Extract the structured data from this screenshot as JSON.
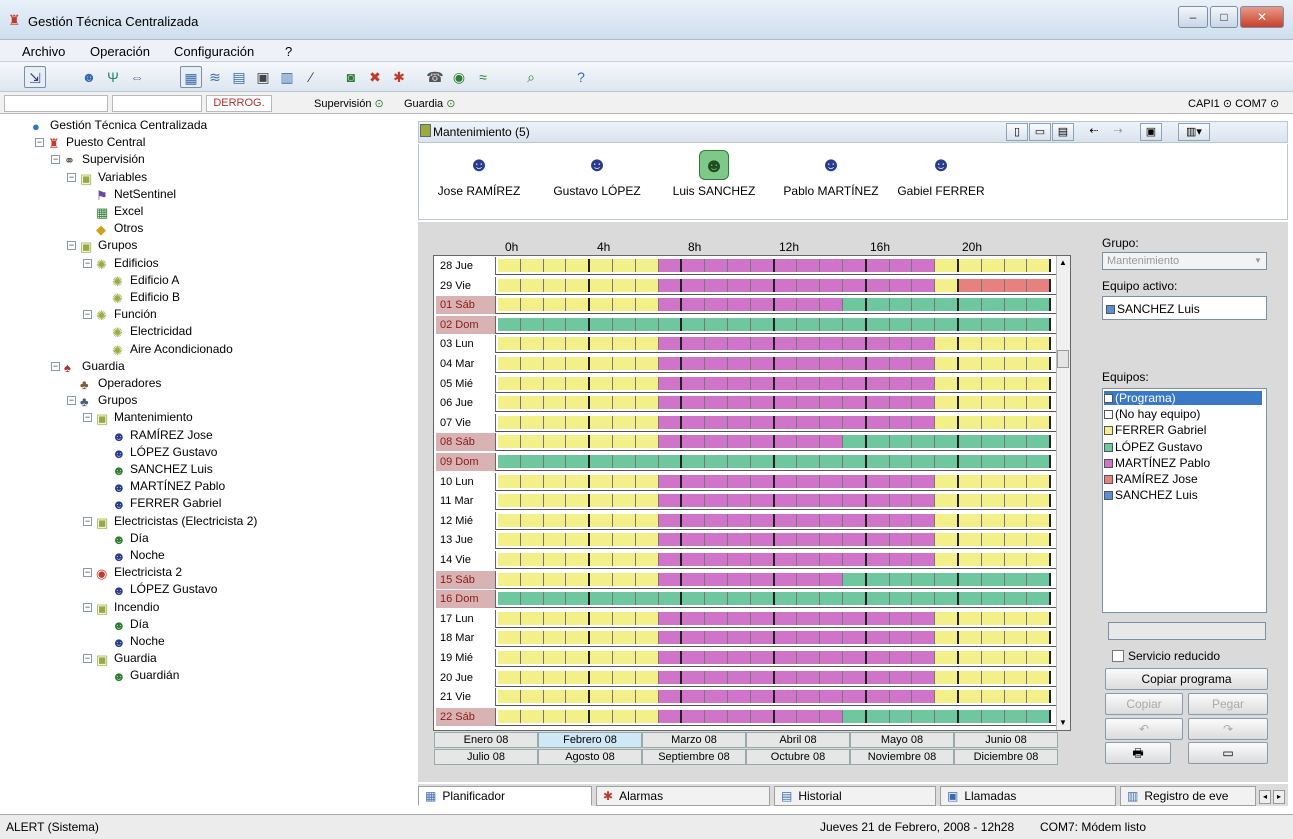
{
  "window": {
    "title": "Gestión Técnica Centralizada",
    "min": "–",
    "max": "□",
    "close": "✕"
  },
  "menu": [
    "Archivo",
    "Operación",
    "Configuración",
    "?"
  ],
  "statusline": {
    "derrog": "DERROG.",
    "supervision": "Supervisión",
    "guardia": "Guardia",
    "port": "CAPI1 ⊙ COM7 ⊙"
  },
  "tree": [
    {
      "label": "Gestión Técnica Centralizada",
      "level": 0,
      "icon": "globe-icon",
      "color": "#2a7bbf"
    },
    {
      "label": "Puesto Central",
      "level": 1,
      "icon": "tower-icon",
      "color": "#c0392b"
    },
    {
      "label": "Supervisión",
      "level": 2,
      "icon": "binoculars-icon",
      "color": "#5a4a3a"
    },
    {
      "label": "Variables",
      "level": 3,
      "icon": "folder-icon",
      "color": "#9aaa40"
    },
    {
      "label": "NetSentinel",
      "level": 4,
      "icon": "sentinel-icon",
      "color": "#6a4a9a"
    },
    {
      "label": "Excel",
      "level": 4,
      "icon": "excel-icon",
      "color": "#2e7d32"
    },
    {
      "label": "Otros",
      "level": 4,
      "icon": "other-icon",
      "color": "#d4a017"
    },
    {
      "label": "Grupos",
      "level": 3,
      "icon": "folder-icon",
      "color": "#9aaa40"
    },
    {
      "label": "Edificios",
      "level": 4,
      "icon": "dot-icon",
      "color": "#9aaa40"
    },
    {
      "label": "Edificio A",
      "level": 5,
      "icon": "dot-icon",
      "color": "#9aaa40"
    },
    {
      "label": "Edificio B",
      "level": 5,
      "icon": "dot-icon",
      "color": "#9aaa40"
    },
    {
      "label": "Función",
      "level": 4,
      "icon": "dot-icon",
      "color": "#9aaa40"
    },
    {
      "label": "Electricidad",
      "level": 5,
      "icon": "dot-icon",
      "color": "#9aaa40"
    },
    {
      "label": "Aire Acondicionado",
      "level": 5,
      "icon": "dot-icon",
      "color": "#9aaa40"
    },
    {
      "label": "Guardia",
      "level": 2,
      "icon": "guard-icon",
      "color": "#b03030"
    },
    {
      "label": "Operadores",
      "level": 3,
      "icon": "operators-icon",
      "color": "#7a5a3a"
    },
    {
      "label": "Grupos",
      "level": 3,
      "icon": "groups-icon",
      "color": "#4a5a7a"
    },
    {
      "label": "Mantenimiento",
      "level": 4,
      "icon": "group-icon",
      "color": "#9aaa40"
    },
    {
      "label": "RAMÍREZ Jose",
      "level": 5,
      "icon": "person-icon",
      "color": "#2b3d8a"
    },
    {
      "label": "LÓPEZ Gustavo",
      "level": 5,
      "icon": "person-icon",
      "color": "#2b3d8a"
    },
    {
      "label": "SANCHEZ Luis",
      "level": 5,
      "icon": "person-active-icon",
      "color": "#2e7d32"
    },
    {
      "label": "MARTÍNEZ  Pablo",
      "level": 5,
      "icon": "person-icon",
      "color": "#2b3d8a"
    },
    {
      "label": "FERRER Gabriel",
      "level": 5,
      "icon": "person-icon",
      "color": "#2b3d8a"
    },
    {
      "label": "Electricistas (Electricista 2)",
      "level": 4,
      "icon": "group-icon",
      "color": "#9aaa40"
    },
    {
      "label": "Día",
      "level": 5,
      "icon": "person-active-icon",
      "color": "#2e7d32"
    },
    {
      "label": "Noche",
      "level": 5,
      "icon": "person-icon",
      "color": "#2b3d8a"
    },
    {
      "label": "Electricista 2",
      "level": 4,
      "icon": "group-alert-icon",
      "color": "#c0392b"
    },
    {
      "label": "LÓPEZ Gustavo",
      "level": 5,
      "icon": "person-icon",
      "color": "#2b3d8a"
    },
    {
      "label": "Incendio",
      "level": 4,
      "icon": "group-icon",
      "color": "#9aaa40"
    },
    {
      "label": "Día",
      "level": 5,
      "icon": "person-active-icon",
      "color": "#2e7d32"
    },
    {
      "label": "Noche",
      "level": 5,
      "icon": "person-icon",
      "color": "#2b3d8a"
    },
    {
      "label": "Guardia",
      "level": 4,
      "icon": "group-icon",
      "color": "#9aaa40"
    },
    {
      "label": "Guardián",
      "level": 5,
      "icon": "person-active-icon",
      "color": "#2e7d32"
    }
  ],
  "panel": {
    "title": "Mantenimiento (5)"
  },
  "persons": [
    "Jose RAMÍREZ",
    "Gustavo LÓPEZ",
    "Luis SANCHEZ",
    "Pablo MARTÍNEZ",
    "Gabiel FERRER"
  ],
  "hours": [
    "0h",
    "4h",
    "8h",
    "12h",
    "16h",
    "20h"
  ],
  "colors": {
    "yellow": "#f3f08a",
    "magenta": "#cf74c9",
    "green": "#6fc7a0",
    "red": "#e88080",
    "blue": "#5b8fd1",
    "white": "#ffffff"
  },
  "days": [
    {
      "label": "28 Jue",
      "weekend": false,
      "pattern": "wk"
    },
    {
      "label": "29 Vie",
      "weekend": false,
      "pattern": "wk_red"
    },
    {
      "label": "01 Sáb",
      "weekend": true,
      "pattern": "sat"
    },
    {
      "label": "02 Dom",
      "weekend": true,
      "pattern": "sun"
    },
    {
      "label": "03 Lun",
      "weekend": false,
      "pattern": "wk"
    },
    {
      "label": "04 Mar",
      "weekend": false,
      "pattern": "wk"
    },
    {
      "label": "05 Mié",
      "weekend": false,
      "pattern": "wk"
    },
    {
      "label": "06 Jue",
      "weekend": false,
      "pattern": "wk"
    },
    {
      "label": "07 Vie",
      "weekend": false,
      "pattern": "wk"
    },
    {
      "label": "08 Sáb",
      "weekend": true,
      "pattern": "sat"
    },
    {
      "label": "09 Dom",
      "weekend": true,
      "pattern": "sun"
    },
    {
      "label": "10 Lun",
      "weekend": false,
      "pattern": "wk"
    },
    {
      "label": "11 Mar",
      "weekend": false,
      "pattern": "wk"
    },
    {
      "label": "12 Mié",
      "weekend": false,
      "pattern": "wk"
    },
    {
      "label": "13 Jue",
      "weekend": false,
      "pattern": "wk"
    },
    {
      "label": "14 Vie",
      "weekend": false,
      "pattern": "wk"
    },
    {
      "label": "15 Sáb",
      "weekend": true,
      "pattern": "sat"
    },
    {
      "label": "16 Dom",
      "weekend": true,
      "pattern": "sun"
    },
    {
      "label": "17 Lun",
      "weekend": false,
      "pattern": "wk"
    },
    {
      "label": "18 Mar",
      "weekend": false,
      "pattern": "wk"
    },
    {
      "label": "19 Mié",
      "weekend": false,
      "pattern": "wk"
    },
    {
      "label": "20 Jue",
      "weekend": false,
      "pattern": "wk"
    },
    {
      "label": "21 Vie",
      "weekend": false,
      "pattern": "wk"
    },
    {
      "label": "22 Sáb",
      "weekend": true,
      "pattern": "sat"
    }
  ],
  "months_row1": [
    "Enero 08",
    "Febrero 08",
    "Marzo 08",
    "Abril 08",
    "Mayo 08",
    "Junio 08"
  ],
  "months_row2": [
    "Julio 08",
    "Agosto 08",
    "Septiembre 08",
    "Octubre 08",
    "Noviembre 08",
    "Diciembre 08"
  ],
  "selected_month": "Febrero 08",
  "right": {
    "grupo_label": "Grupo:",
    "grupo_value": "Mantenimiento",
    "equipo_activo_label": "Equipo activo:",
    "equipo_activo_value": "SANCHEZ Luis",
    "equipos_label": "Equipos:",
    "equipos": [
      {
        "label": "(Programa)",
        "color": "#ffffff",
        "selected": true
      },
      {
        "label": "(No hay equipo)",
        "color": "#ffffff",
        "selected": false
      },
      {
        "label": "FERRER Gabriel",
        "color": "#f3f08a",
        "selected": false
      },
      {
        "label": "LÓPEZ Gustavo",
        "color": "#6fc7a0",
        "selected": false
      },
      {
        "label": "MARTÍNEZ  Pablo",
        "color": "#cf74c9",
        "selected": false
      },
      {
        "label": "RAMÍREZ Jose",
        "color": "#e88080",
        "selected": false
      },
      {
        "label": "SANCHEZ Luis",
        "color": "#5b8fd1",
        "selected": false
      }
    ],
    "servicio": "Servicio reducido",
    "copiar": "Copiar programa",
    "copiar2": "Copiar",
    "pegar": "Pegar",
    "undo": "↶",
    "redo": "↷",
    "print": "🖶",
    "screen": "▭"
  },
  "bottom_tabs": [
    "Planificador",
    "Alarmas",
    "Historial",
    "Llamadas",
    "Registro de eve"
  ],
  "status": {
    "left": "ALERT (Sistema)",
    "date": "Jueves 21 de Febrero, 2008 - 12h28",
    "modem": "COM7: Módem listo"
  }
}
